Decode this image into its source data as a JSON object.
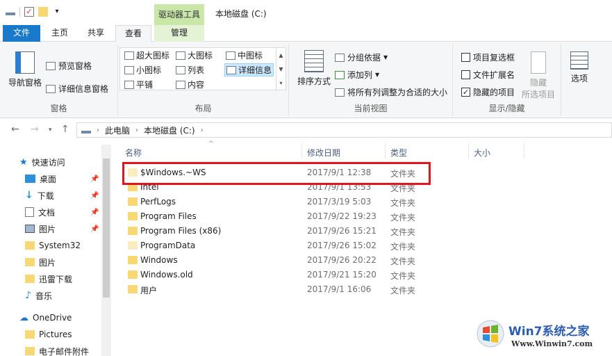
{
  "window": {
    "title": "本地磁盘 (C:)",
    "context_tab_header": "驱动器工具"
  },
  "ribbon_tabs": {
    "file": "文件",
    "home": "主页",
    "share": "共享",
    "view": "查看",
    "manage": "管理"
  },
  "ribbon": {
    "panes": {
      "label": "窗格",
      "nav_pane": "导航窗格",
      "preview_pane": "预览窗格",
      "details_pane": "详细信息窗格"
    },
    "layout": {
      "label": "布局",
      "extra_large_icons": "超大图标",
      "large_icons": "大图标",
      "medium_icons": "中图标",
      "small_icons": "小图标",
      "list": "列表",
      "details": "详细信息",
      "tiles": "平铺",
      "content": "内容"
    },
    "current_view": {
      "label": "当前视图",
      "sort_by": "排序方式",
      "group_by": "分组依据",
      "add_columns": "添加列",
      "size_all_columns": "将所有列调整为合适的大小"
    },
    "show_hide": {
      "label": "显示/隐藏",
      "item_checkboxes": "项目复选框",
      "file_extensions": "文件扩展名",
      "hidden_items": "隐藏的项目",
      "hide_selected_line1": "隐藏",
      "hide_selected_line2": "所选项目",
      "checks": {
        "item_checkboxes": false,
        "file_extensions": false,
        "hidden_items": true
      }
    },
    "options": "选项"
  },
  "address": {
    "crumbs": [
      "此电脑",
      "本地磁盘 (C:)"
    ]
  },
  "navpane": {
    "quick_access": "快速访问",
    "items": [
      {
        "label": "桌面",
        "pinned": true
      },
      {
        "label": "下载",
        "pinned": true
      },
      {
        "label": "文档",
        "pinned": true
      },
      {
        "label": "图片",
        "pinned": true
      },
      {
        "label": "System32",
        "pinned": false
      },
      {
        "label": "图片",
        "pinned": false
      },
      {
        "label": "迅雷下载",
        "pinned": false
      },
      {
        "label": "音乐",
        "pinned": false
      }
    ],
    "onedrive": "OneDrive",
    "onedrive_items": [
      "Pictures",
      "电子邮件附件"
    ]
  },
  "columns": {
    "name": "名称",
    "modified": "修改日期",
    "type": "类型",
    "size": "大小"
  },
  "files": [
    {
      "name": "$Windows.~WS",
      "modified": "2017/9/1 12:38",
      "type": "文件夹",
      "pale": true
    },
    {
      "name": "Intel",
      "modified": "2017/9/1 13:53",
      "type": "文件夹",
      "pale": false
    },
    {
      "name": "PerfLogs",
      "modified": "2017/3/19 5:03",
      "type": "文件夹",
      "pale": false
    },
    {
      "name": "Program Files",
      "modified": "2017/9/22 19:23",
      "type": "文件夹",
      "pale": false
    },
    {
      "name": "Program Files (x86)",
      "modified": "2017/9/26 15:21",
      "type": "文件夹",
      "pale": false
    },
    {
      "name": "ProgramData",
      "modified": "2017/9/26 15:02",
      "type": "文件夹",
      "pale": true
    },
    {
      "name": "Windows",
      "modified": "2017/9/26 20:22",
      "type": "文件夹",
      "pale": false
    },
    {
      "name": "Windows.old",
      "modified": "2017/9/21 15:20",
      "type": "文件夹",
      "pale": false
    },
    {
      "name": "用户",
      "modified": "2017/9/1 16:06",
      "type": "文件夹",
      "pale": false
    }
  ],
  "watermark": {
    "brand": "Win7系统之家",
    "url": "Www.Winwin7.com"
  },
  "colors": {
    "file_tab": "#1979ca",
    "context_tab": "#c9e7a8",
    "highlight_box": "#e3141b",
    "folder": "#f8d775"
  }
}
